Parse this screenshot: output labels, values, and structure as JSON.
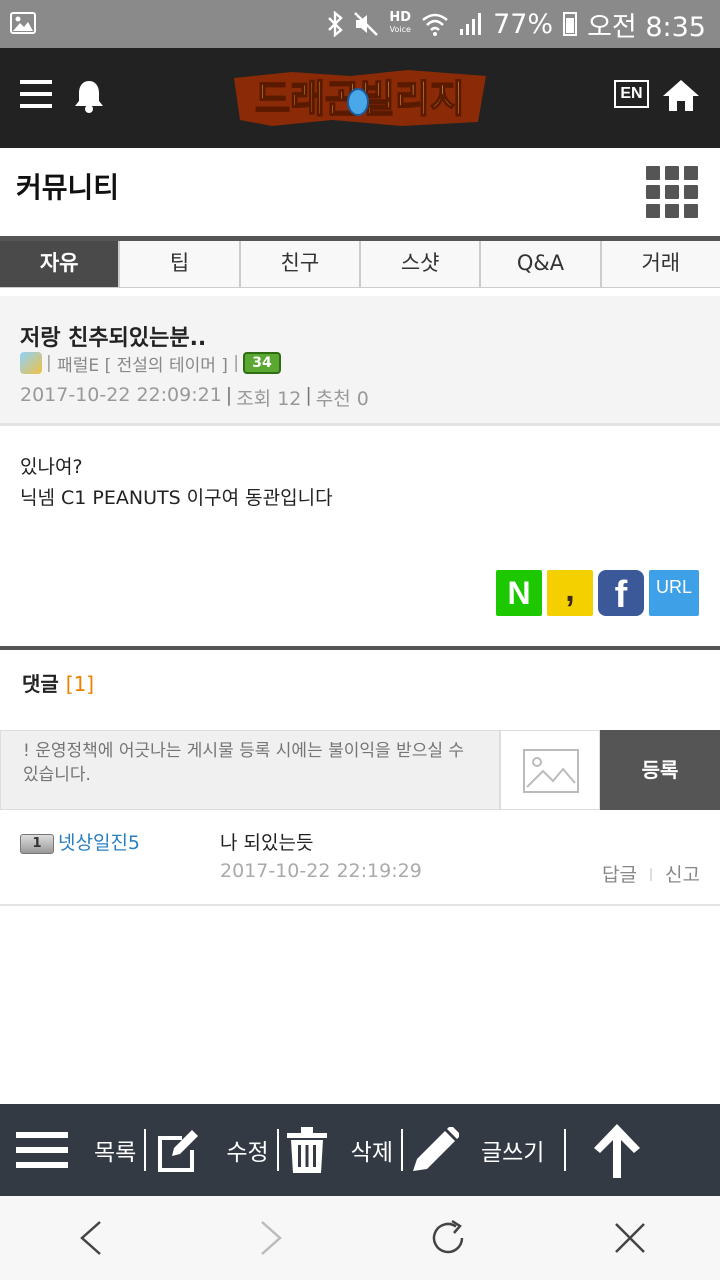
{
  "status_bar": {
    "hd_label": "HD",
    "voice_label": "Voice",
    "battery": "77%",
    "time": "오전 8:35"
  },
  "header": {
    "logo_text": "드래곤빌리지",
    "lang_label": "EN"
  },
  "page": {
    "title": "커뮤니티"
  },
  "tabs": [
    {
      "label": "자유",
      "active": true
    },
    {
      "label": "팁",
      "active": false
    },
    {
      "label": "친구",
      "active": false
    },
    {
      "label": "스샷",
      "active": false
    },
    {
      "label": "Q&A",
      "active": false
    },
    {
      "label": "거래",
      "active": false
    }
  ],
  "post": {
    "title": "저랑 친추되있는분..",
    "author_nick": "패럴E",
    "author_title": "[ 전설의 테이머 ]",
    "author_level": "34",
    "date": "2017-10-22 22:09:21",
    "views_label": "조회 12",
    "recommend_label": "추천 0",
    "body_line1": "있나여?",
    "body_line2": "닉넴 C1 PEANUTS 이구여 동관입니다"
  },
  "share": {
    "naver": "N",
    "kakao": ",",
    "facebook": "f",
    "url": "URL"
  },
  "comments": {
    "title": "댓글",
    "count": "[1]",
    "input_placeholder": "! 운영정책에 어긋나는 게시물 등록 시에는 불이익을 받으실 수 있습니다.",
    "submit_label": "등록",
    "items": [
      {
        "level": "1",
        "author": "넷상일진5",
        "text": "나 되있는듯",
        "date": "2017-10-22 22:19:29",
        "reply_label": "답글",
        "report_label": "신고"
      }
    ]
  },
  "toolbar": {
    "list_label": "목록",
    "edit_label": "수정",
    "delete_label": "삭제",
    "write_label": "글쓰기"
  },
  "colors": {
    "header_bg": "#222222",
    "active_tab": "#4a4a4a",
    "comment_count": "#f08000",
    "author_link": "#2a7fc0",
    "toolbar_bg": "#333a44"
  }
}
